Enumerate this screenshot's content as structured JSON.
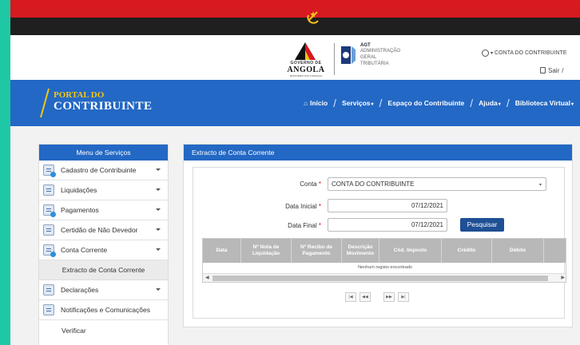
{
  "header": {
    "gov_small": "GOVERNO DE",
    "gov_name": "ANGOLA",
    "gov_tiny": "MINISTÉRIO DAS FINANÇAS",
    "agt_abbr": "AGT",
    "agt_line1": "ADMINISTRAÇÃO",
    "agt_line2": "GERAL",
    "agt_line3": "TRIBUTÁRIA",
    "account_label": "CONTA DO CONTRIBUINTE",
    "logout_label": "Sair",
    "logout_sep": "/"
  },
  "nav": {
    "portal_line1": "PORTAL DO",
    "portal_line2": "CONTRIBUINTE",
    "items": [
      {
        "label": "Início"
      },
      {
        "label": "Serviços"
      },
      {
        "label": "Espaço do Contribuinte"
      },
      {
        "label": "Ajuda"
      },
      {
        "label": "Biblioteca Virtual"
      }
    ],
    "separator": "/"
  },
  "sidebar": {
    "title": "Menu de Serviços",
    "items": [
      {
        "label": "Cadastro de Contribuinte"
      },
      {
        "label": "Liquidações"
      },
      {
        "label": "Pagamentos"
      },
      {
        "label": "Certidão de Não Devedor"
      },
      {
        "label": "Conta Corrente"
      },
      {
        "label": "Extracto de Conta Corrente"
      },
      {
        "label": "Declarações"
      },
      {
        "label": "Notificações e Comunicações"
      },
      {
        "label": "Verificar"
      }
    ]
  },
  "panel": {
    "title": "Extracto de Conta Corrente",
    "conta_label": "Conta",
    "conta_value": "CONTA DO CONTRIBUINTE",
    "data_inicial_label": "Data Inicial",
    "data_inicial_value": "07/12/2021",
    "data_final_label": "Data Final",
    "data_final_value": "07/12/2021",
    "required_mark": "*",
    "search_button": "Pesquisar",
    "columns": [
      "Data",
      "Nº Nota de Liquidação",
      "Nº Recibo de Pagamento",
      "Descrição Movimento",
      "Cód. Imposto",
      "Crédito",
      "Débito"
    ],
    "empty_message": "Nenhum registo encontrado",
    "pager": [
      "|◀",
      "◀◀",
      "▶▶",
      "▶|"
    ]
  },
  "colors": {
    "brand_blue": "#2368c4",
    "flag_red": "#d71920",
    "flag_black": "#1f1f1f",
    "accent_yellow": "#f5c415",
    "button_dark": "#1f4f95",
    "frame_teal": "#1fc8a4"
  }
}
